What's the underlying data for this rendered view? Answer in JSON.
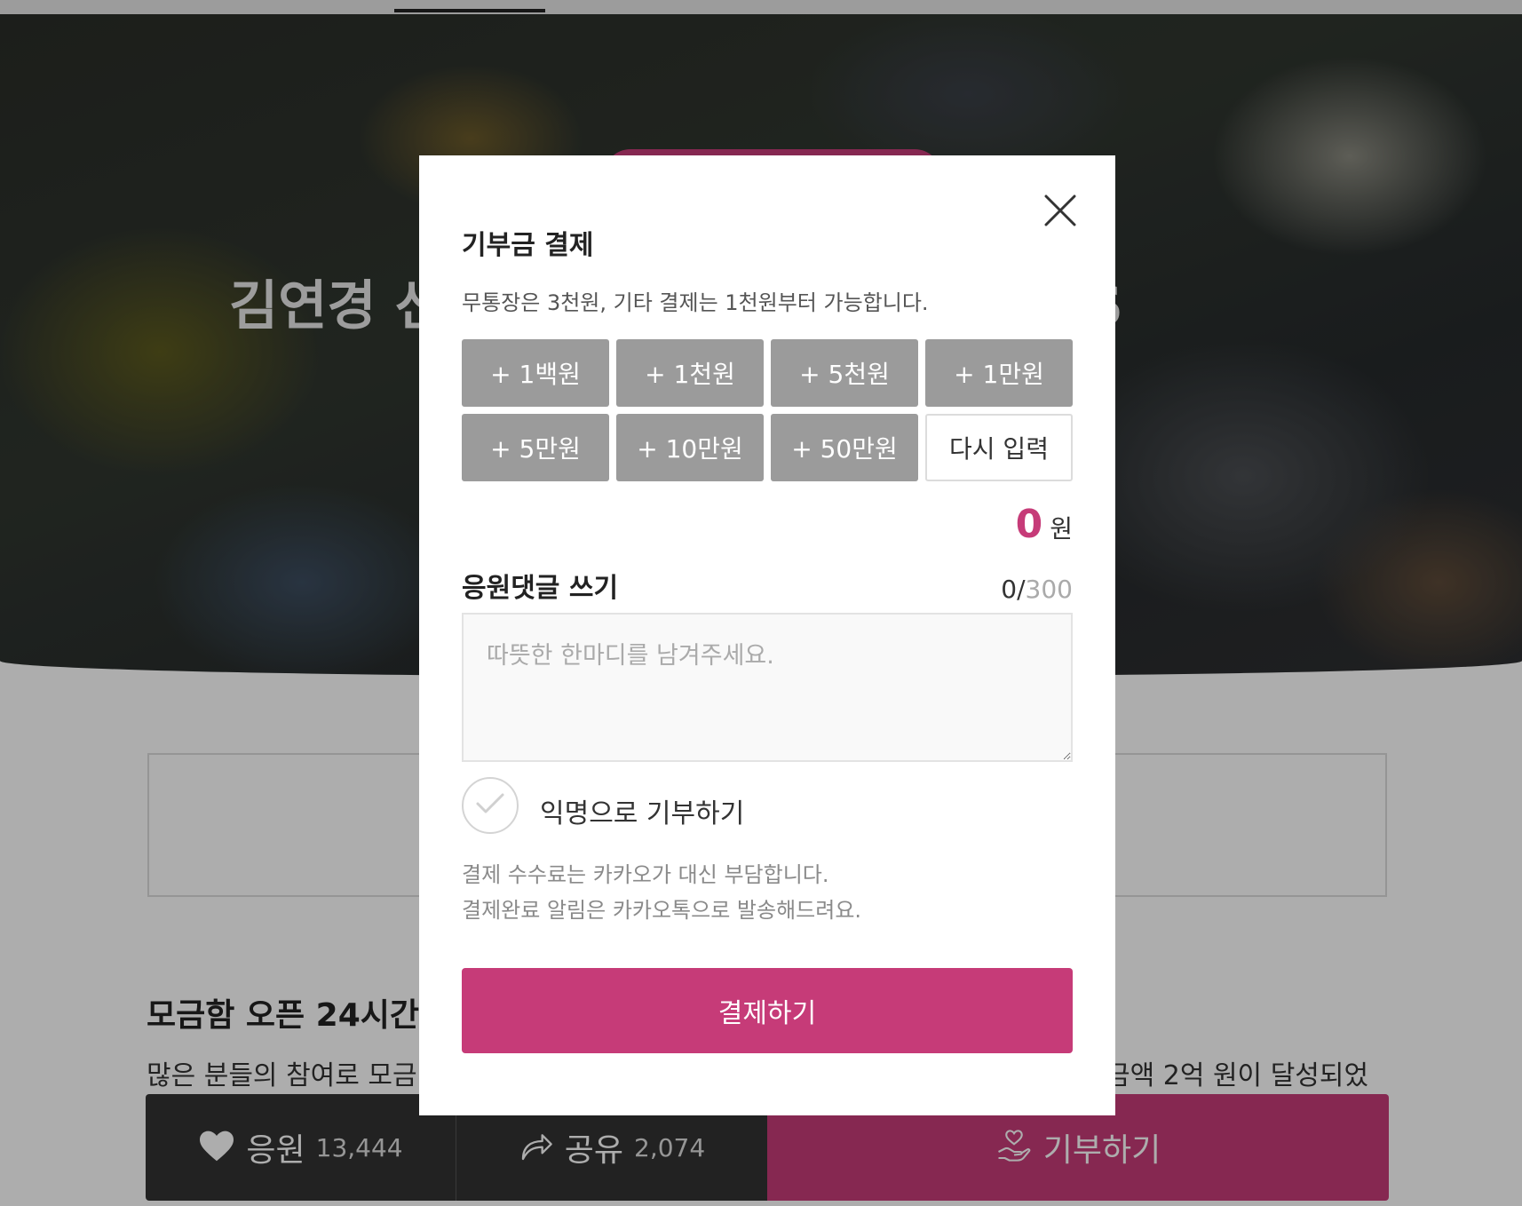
{
  "page": {
    "hero_title": "김연경 선수와 함께하는 Voice and S",
    "section_title": "모금함 오픈 24시간",
    "section_body_start": "많은 분들의 참여로 모금",
    "section_body_end": "금액 2억 원이 달성되었"
  },
  "bottom_bar": {
    "cheer_label": "응원",
    "cheer_count": "13,444",
    "share_label": "공유",
    "share_count": "2,074",
    "donate_label": "기부하기"
  },
  "modal": {
    "title": "기부금 결제",
    "description": "무통장은 3천원, 기타 결제는 1천원부터 가능합니다.",
    "amount_buttons": [
      "+ 1백원",
      "+ 1천원",
      "+ 5천원",
      "+ 1만원",
      "+ 5만원",
      "+ 10만원",
      "+ 50만원"
    ],
    "reset_label": "다시 입력",
    "total_value": "0",
    "total_unit": "원",
    "comment_label": "응원댓글 쓰기",
    "char_count_current": "0",
    "char_count_max": "300",
    "comment_placeholder": "따뜻한 한마디를 남겨주세요.",
    "anonymous_label": "익명으로 기부하기",
    "fee_note_line1": "결제 수수료는 카카오가 대신 부담합니다.",
    "fee_note_line2": "결제완료 알림은 카카오톡으로 발송해드려요.",
    "pay_label": "결제하기"
  },
  "colors": {
    "accent": "#c63b78",
    "amount_button": "#9b9b9b",
    "bar_dark": "#333333"
  },
  "icons": {
    "close": "close-icon",
    "check": "check-icon",
    "heart": "heart-icon",
    "share": "share-icon",
    "donate": "donate-hand-heart-icon"
  }
}
